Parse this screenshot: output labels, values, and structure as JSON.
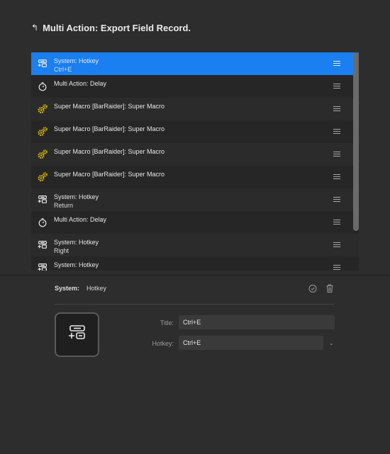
{
  "header": {
    "back_glyph": "↰",
    "title": "Multi Action: Export Field Record."
  },
  "actions": [
    {
      "icon": "hotkey-icon",
      "line1": "System: Hotkey",
      "line2": "Ctrl+E",
      "selected": true
    },
    {
      "icon": "timer-icon",
      "line1": "Multi Action: Delay",
      "line2": ""
    },
    {
      "icon": "gears-icon",
      "line1": "Super Macro [BarRaider]: Super Macro",
      "line2": ""
    },
    {
      "icon": "gears-icon",
      "line1": "Super Macro [BarRaider]: Super Macro",
      "line2": ""
    },
    {
      "icon": "gears-icon",
      "line1": "Super Macro [BarRaider]: Super Macro",
      "line2": ""
    },
    {
      "icon": "gears-icon",
      "line1": "Super Macro [BarRaider]: Super Macro",
      "line2": ""
    },
    {
      "icon": "hotkey-icon",
      "line1": "System: Hotkey",
      "line2": "Return"
    },
    {
      "icon": "timer-icon",
      "line1": "Multi Action: Delay",
      "line2": ""
    },
    {
      "icon": "hotkey-icon",
      "line1": "System: Hotkey",
      "line2": "Right"
    },
    {
      "icon": "hotkey-icon",
      "line1": "System: Hotkey",
      "line2": ""
    }
  ],
  "properties": {
    "category": "System:",
    "action": "Hotkey",
    "title_label": "Title:",
    "title_value": "Ctrl+E",
    "hotkey_label": "Hotkey:",
    "hotkey_value": "Ctrl+E"
  },
  "colors": {
    "accent": "#1a7ff0",
    "gear": "#e8c400"
  }
}
